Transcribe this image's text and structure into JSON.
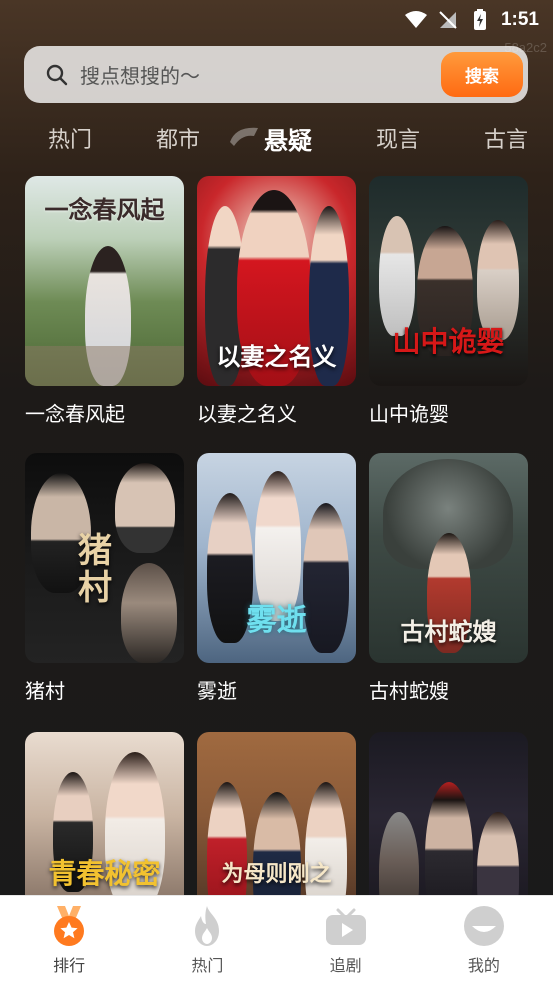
{
  "status_bar": {
    "time": "1:51"
  },
  "watermark": "58a2c2",
  "search": {
    "placeholder": "搜点想搜的～",
    "button_label": "搜索"
  },
  "tabs": [
    {
      "label": "热门",
      "active": false
    },
    {
      "label": "都市",
      "active": false
    },
    {
      "label": "悬疑",
      "active": true
    },
    {
      "label": "现言",
      "active": false
    },
    {
      "label": "古言",
      "active": false
    }
  ],
  "dramas": [
    {
      "title": "一念春风起",
      "poster_text": "一念春风起"
    },
    {
      "title": "以妻之名义",
      "poster_text": "以妻之名义"
    },
    {
      "title": "山中诡婴",
      "poster_text": "山中诡婴"
    },
    {
      "title": "猪村",
      "poster_text": "猪村"
    },
    {
      "title": "雾逝",
      "poster_text": "雾逝"
    },
    {
      "title": "古村蛇嫂",
      "poster_text": "古村蛇嫂"
    },
    {
      "title": "",
      "poster_text": "青春秘密"
    },
    {
      "title": "",
      "poster_text": "为母则刚之"
    },
    {
      "title": "",
      "poster_text": ""
    }
  ],
  "bottom_nav": [
    {
      "label": "排行",
      "icon": "rank-medal-icon",
      "active": true
    },
    {
      "label": "热门",
      "icon": "flame-icon",
      "active": false
    },
    {
      "label": "追剧",
      "icon": "tv-play-icon",
      "active": false
    },
    {
      "label": "我的",
      "icon": "profile-icon",
      "active": false
    }
  ],
  "colors": {
    "accent": "#ff7a1f",
    "nav_inactive": "#cfcfcf"
  }
}
